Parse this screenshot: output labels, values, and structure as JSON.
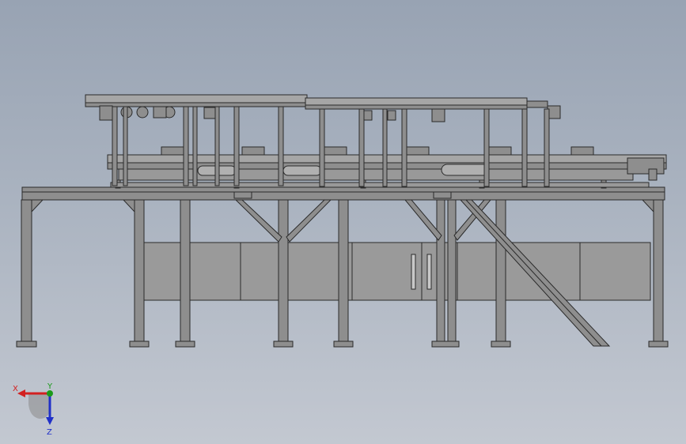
{
  "view": {
    "background_top": "#98a3b3",
    "background_bottom": "#c3c8d1"
  },
  "model": {
    "frame_fill": "#8e8e8e",
    "frame_stroke": "#2a2a2a",
    "panel_fill": "#9a9a9a",
    "conveyor_fill": "#a6a6a6"
  },
  "triad": {
    "x_label": "X",
    "y_label": "Y",
    "z_label": "Z",
    "x_color": "#d22020",
    "y_color": "#1a9a1a",
    "z_color": "#2030c8"
  }
}
